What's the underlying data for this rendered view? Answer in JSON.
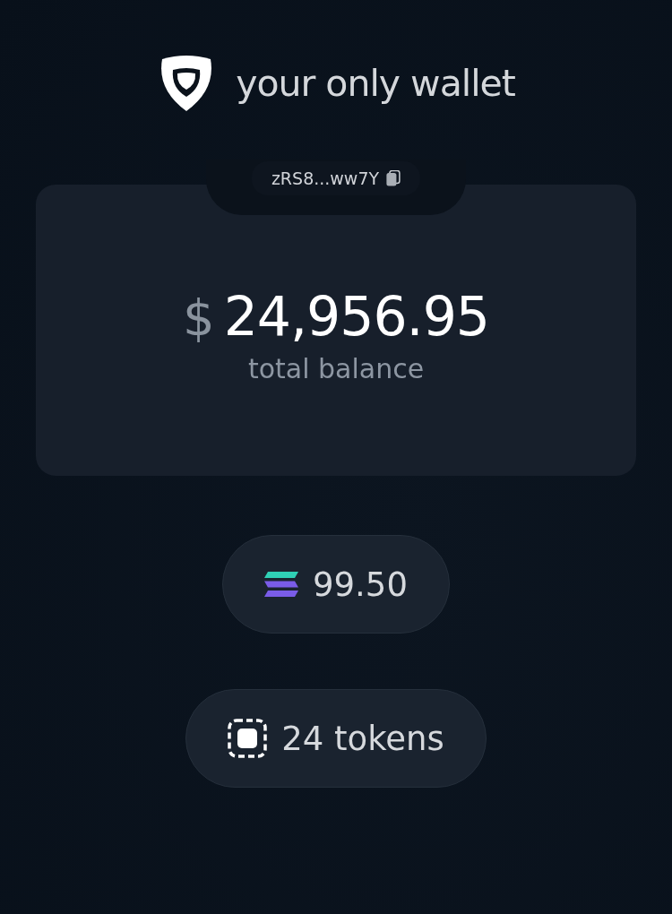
{
  "header": {
    "title": "your only wallet"
  },
  "balance_card": {
    "address": "zRS8...ww7Y",
    "currency": "$",
    "amount": "24,956.95",
    "caption": "total balance"
  },
  "pills": [
    {
      "kind": "sol",
      "label": "99.50"
    },
    {
      "kind": "tokens",
      "label": "24 tokens"
    }
  ]
}
